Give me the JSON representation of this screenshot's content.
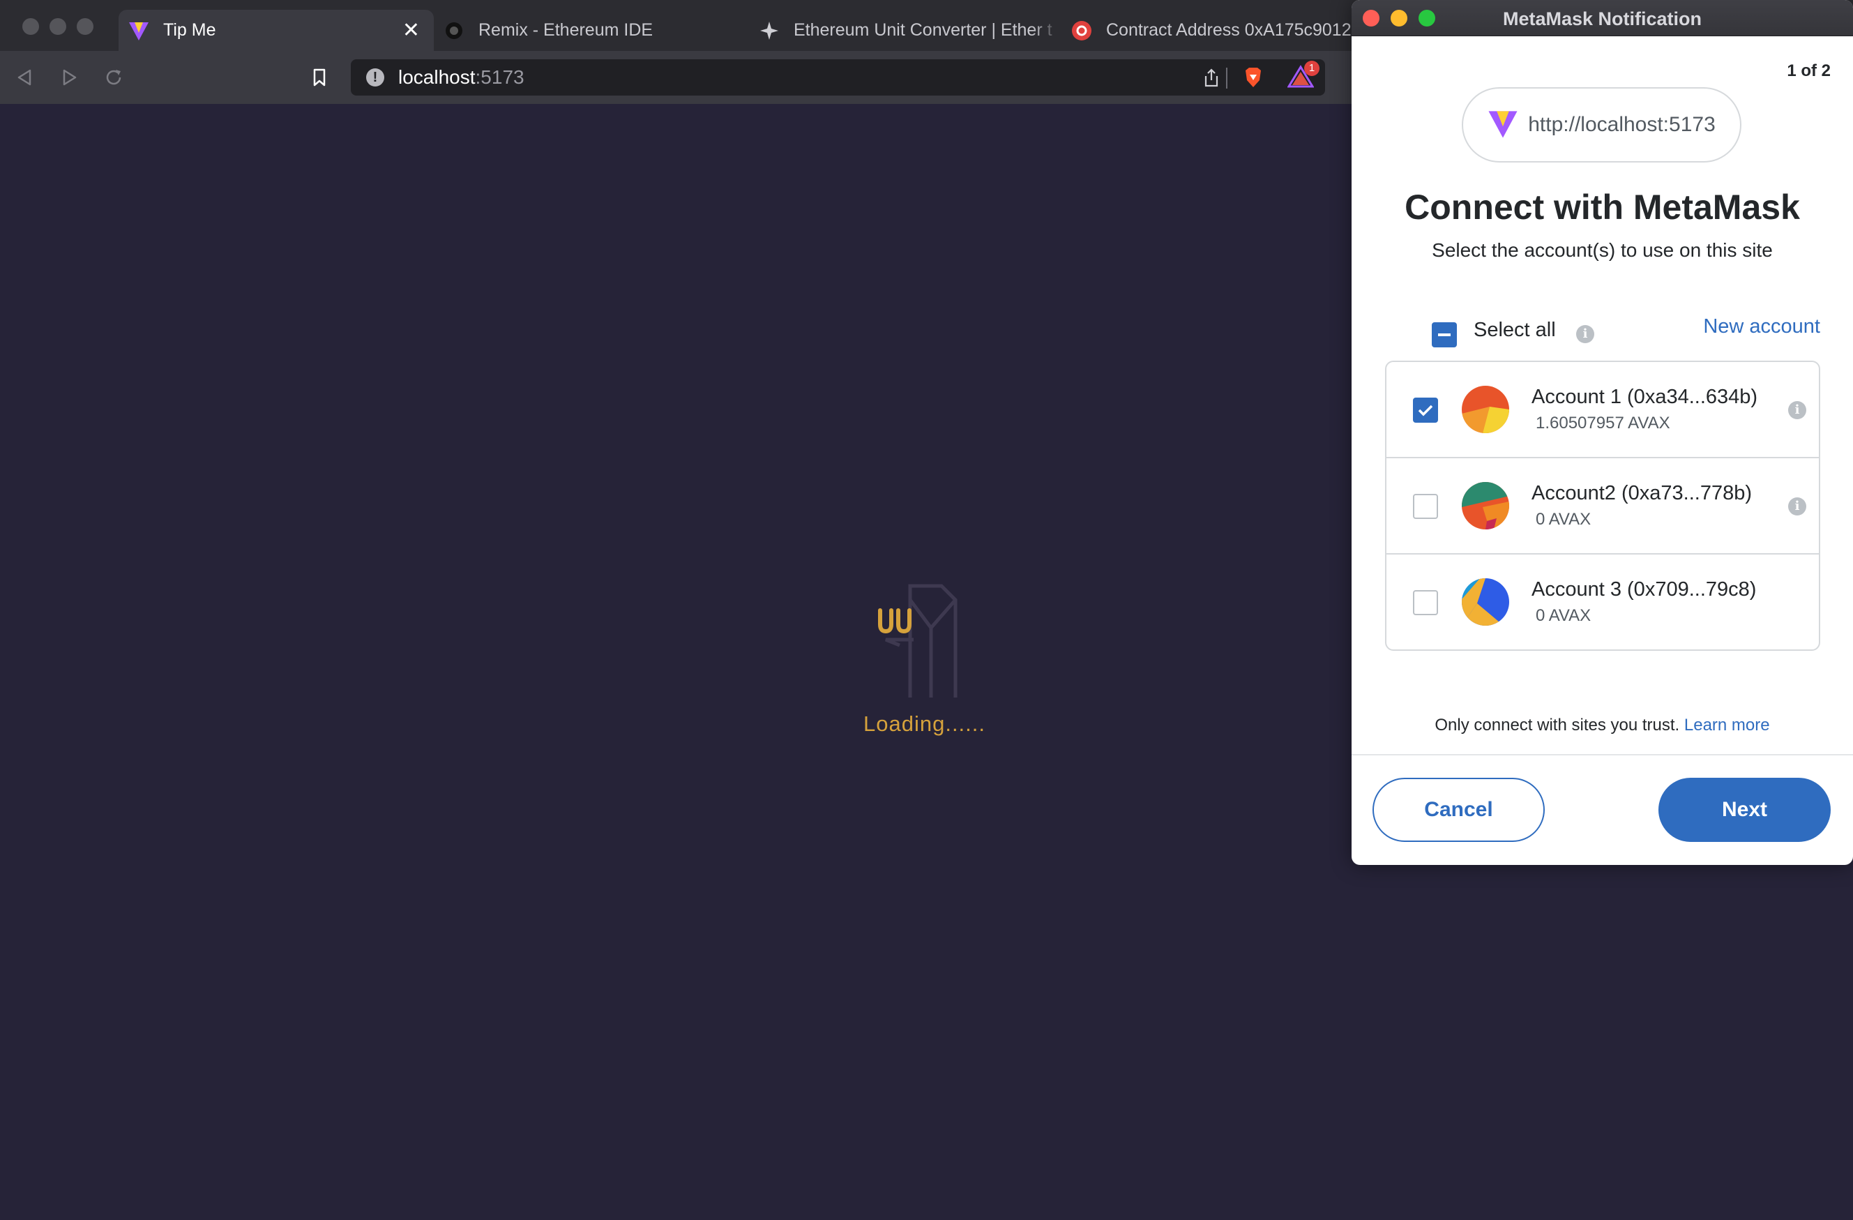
{
  "browser": {
    "tabs": [
      {
        "title": "Tip Me",
        "active": true
      },
      {
        "title": "Remix - Ethereum IDE",
        "active": false
      },
      {
        "title": "Ethereum Unit Converter | Ether t",
        "active": false
      },
      {
        "title": "Contract Address 0xA175c9012",
        "active": false
      }
    ],
    "url_host": "localhost",
    "url_port": ":5173",
    "notification_count": "1"
  },
  "page": {
    "loading_text": "Loading......",
    "accent_color": "#d6a23c",
    "background_color": "#262338"
  },
  "metamask": {
    "window_title": "MetaMask Notification",
    "step": "1 of 2",
    "site_url": "http://localhost:5173",
    "title": "Connect with MetaMask",
    "subtitle": "Select the account(s) to use on this site",
    "select_all_label": "Select all",
    "new_account_label": "New account",
    "accounts": [
      {
        "name": "Account 1 (0xa34...634b)",
        "balance": "1.60507957 AVAX",
        "checked": true
      },
      {
        "name": "Account2 (0xa73...778b)",
        "balance": "0 AVAX",
        "checked": false
      },
      {
        "name": "Account 3 (0x709...79c8)",
        "balance": "0 AVAX",
        "checked": false
      }
    ],
    "trust_text": "Only connect with sites you trust.",
    "learn_more": "Learn more",
    "cancel_label": "Cancel",
    "next_label": "Next",
    "brand_color": "#2f6cbf"
  }
}
